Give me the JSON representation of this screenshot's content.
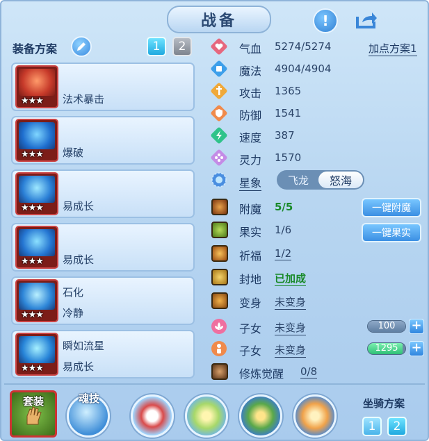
{
  "window": {
    "title": "战备"
  },
  "left": {
    "scheme_label": "装备方案",
    "scheme_buttons": [
      "1",
      "2"
    ],
    "equipment": [
      {
        "line1": "",
        "line2": "法术暴击",
        "stars": "★★★"
      },
      {
        "line1": "",
        "line2": "爆破",
        "stars": "★★★"
      },
      {
        "line1": "",
        "line2": "易成长",
        "stars": "★★★"
      },
      {
        "line1": "",
        "line2": "易成长",
        "stars": "★★★"
      },
      {
        "line1": "石化",
        "line2": "冷静",
        "stars": "★★★"
      },
      {
        "line1": "瞬如流星",
        "line2": "易成长",
        "stars": "★★★"
      }
    ]
  },
  "stats": {
    "add_point": "加点方案1",
    "rows": [
      {
        "label": "气血",
        "value": "5274/5274",
        "icon": "heart-icon",
        "color": "#e6677e"
      },
      {
        "label": "魔法",
        "value": "4904/4904",
        "icon": "mana-icon",
        "color": "#3d9fea"
      },
      {
        "label": "攻击",
        "value": "1365",
        "icon": "sword-icon",
        "color": "#f0a93a"
      },
      {
        "label": "防御",
        "value": "1541",
        "icon": "shield-icon",
        "color": "#f08a4b"
      },
      {
        "label": "速度",
        "value": "387",
        "icon": "speed-icon",
        "color": "#2fc38a"
      },
      {
        "label": "灵力",
        "value": "1570",
        "icon": "spirit-icon",
        "color": "#c48be6"
      }
    ],
    "star": {
      "label": "星象",
      "options": [
        "飞龙",
        "怒海"
      ]
    }
  },
  "extras": {
    "enchant": {
      "label": "附魔",
      "value": "5/5"
    },
    "fruit": {
      "label": "果实",
      "value": "1/6"
    },
    "bless": {
      "label": "祈福",
      "value": "1/2"
    },
    "seal": {
      "label": "封地",
      "value": "已加成"
    },
    "transform": {
      "label": "变身",
      "value": "未变身"
    },
    "child1": {
      "label": "子女",
      "value": "未变身",
      "bar_value": "100",
      "bar_fraction": 1.0
    },
    "child2": {
      "label": "子女",
      "value": "未变身",
      "bar_value": "1295",
      "bar_fraction": 0.92
    },
    "cultivate": {
      "label": "修炼觉醒",
      "value": "0/8"
    },
    "one_click_enchant": "一键附魔",
    "one_click_fruit": "一键果实"
  },
  "bottom": {
    "set_label": "套装",
    "soul_label": "魂技",
    "mount_label": "坐骑方案",
    "mount_buttons": [
      "1",
      "2"
    ]
  },
  "colors": {
    "accent": "#2f85df",
    "green": "#1a8a2a",
    "title": "#2c4a73"
  }
}
